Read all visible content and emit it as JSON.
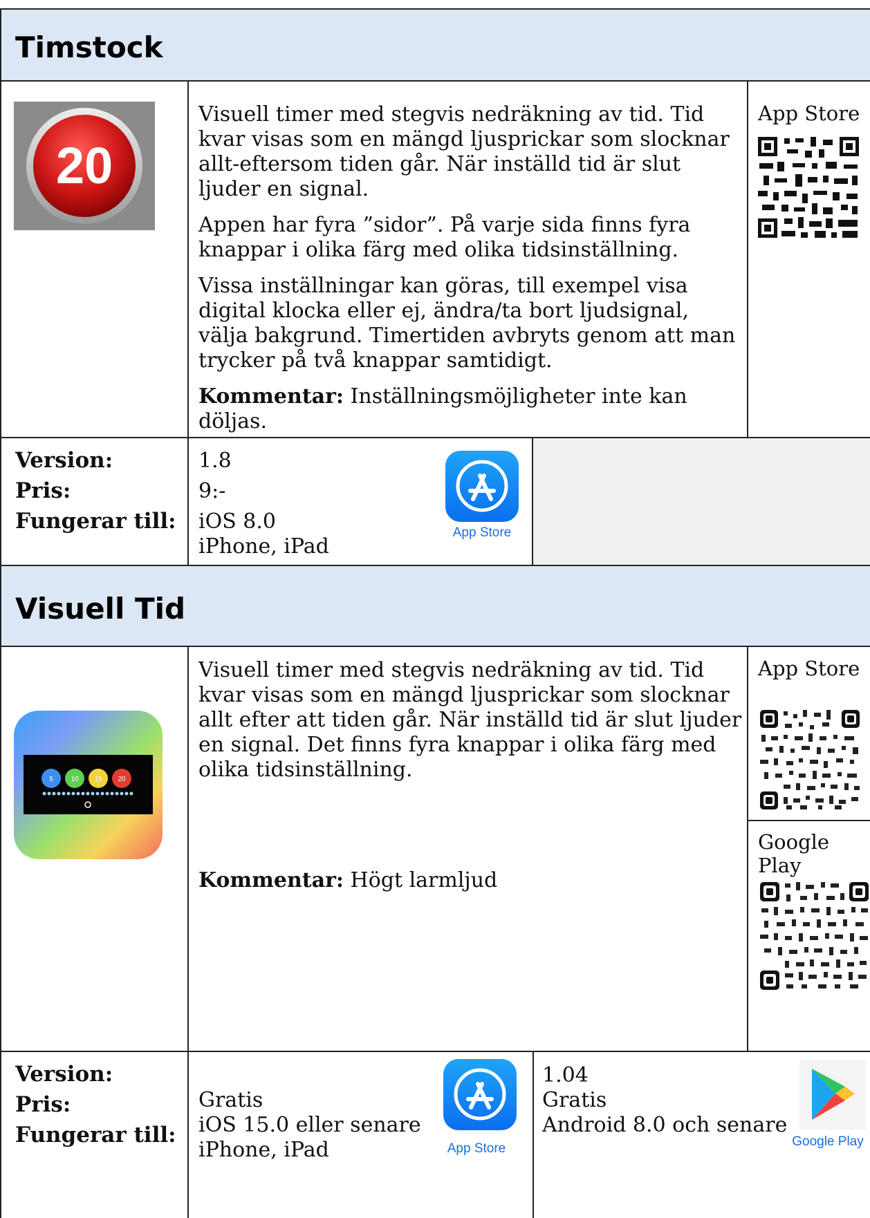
{
  "apps": [
    {
      "title": "Timstock",
      "icon_text": "20",
      "paragraphs": [
        "Visuell timer med stegvis nedräkning av tid. Tid kvar visas som en mängd ljusprickar som slocknar allt-eftersom tiden går. När inställd tid är slut ljuder en signal.",
        "Appen har fyra ”sidor”. På varje sida finns fyra knappar i olika färg med olika tidsinställning.",
        "Vissa inställningar kan göras, till exempel visa digital klocka eller ej, ändra/ta bort ljudsignal, välja bakgrund. Timertiden avbryts genom att man trycker på två knappar samtidigt."
      ],
      "comment_label": "Kommentar:",
      "comment": "Inställningsmöjligheter inte kan döljas.",
      "qr_label": "App Store",
      "labels": {
        "version": "Version:",
        "price": "Pris:",
        "works": "Fungerar till:"
      },
      "ios": {
        "version": "1.8",
        "price": "9:-",
        "os": "iOS 8.0",
        "devices": "iPhone, iPad",
        "badge": "App Store"
      }
    },
    {
      "title": "Visuell Tid",
      "icon_numbers": [
        "5",
        "10",
        "15",
        "20"
      ],
      "paragraphs": [
        "Visuell timer med stegvis nedräkning av tid. Tid kvar visas som en mängd ljusprickar som slocknar allt efter att tiden går. När inställd tid är slut ljuder en signal. Det finns fyra knappar i olika färg med olika tidsinställning."
      ],
      "comment_label": "Kommentar:",
      "comment": "Högt larmljud",
      "qr_label_ios": "App Store",
      "qr_label_android": "Google Play",
      "labels": {
        "version": "Version:",
        "price": "Pris:",
        "works": "Fungerar till:"
      },
      "ios": {
        "price": "Gratis",
        "os": "iOS 15.0 eller senare",
        "devices": "iPhone, iPad",
        "badge": "App Store"
      },
      "android": {
        "version": "1.04",
        "price": "Gratis",
        "os": "Android 8.0 och senare",
        "badge": "Google Play"
      }
    }
  ]
}
